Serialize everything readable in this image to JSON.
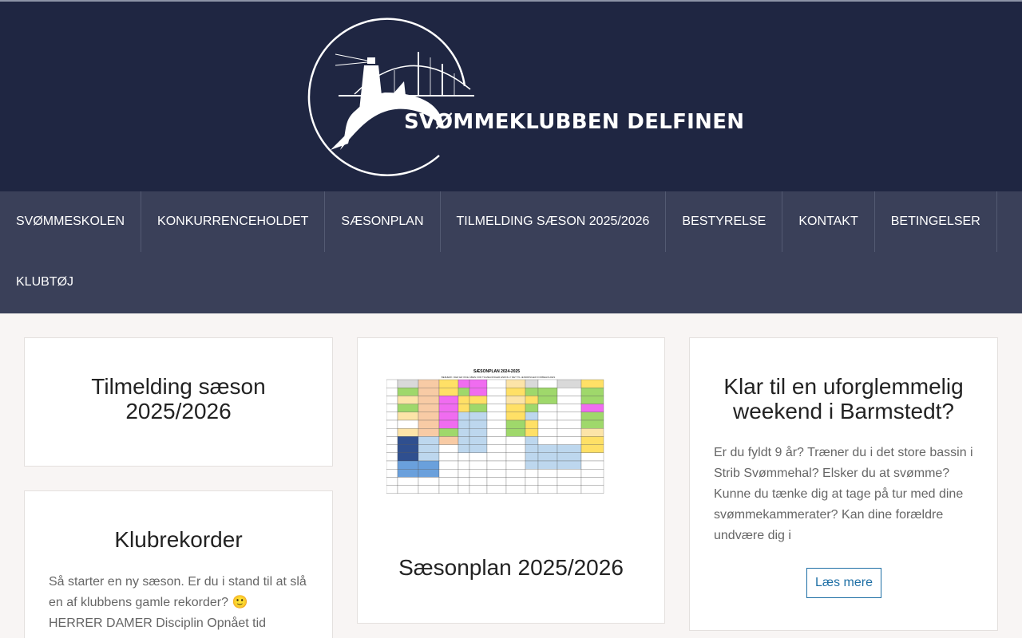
{
  "site": {
    "name": "SVØMMEKLUBBEN DELFINEN",
    "colors": {
      "header_bg": "#1f2642",
      "nav_bg": "#3a4059",
      "page_bg": "#f8f5f4",
      "link": "#1e6fa5"
    }
  },
  "nav": {
    "row1": [
      "SVØMMESKOLEN",
      "KONKURRENCEHOLDET",
      "SÆSONPLAN",
      "TILMELDING SÆSON 2025/2026",
      "BESTYRELSE",
      "KONTAKT",
      "BETINGELSER"
    ],
    "row2": [
      "KLUBTØJ"
    ]
  },
  "cards": {
    "registration": {
      "title": "Tilmelding sæson 2025/2026"
    },
    "records": {
      "title": "Klubrekorder",
      "excerpt_line1": "Så starter en ny sæson. Er du i stand til at slå en af klubbens gamle rekorder? 🙂",
      "excerpt_line2": "HERRER DAMER Disciplin Opnået tid"
    },
    "season_plan": {
      "title": "Sæsonplan 2025/2026",
      "image_title": "SÆSONPLAN 2024-2025",
      "image_subtitle": "BEMÆRK: DER ER IKKE ÅBEN FOR TILMELDINGER ENDNU // RET TIL ÆNDRINGER FORBEHOLDES"
    },
    "barmstedt": {
      "title": "Klar til en uforglemmelig weekend i Barmstedt?",
      "excerpt": "Er du fyldt 9 år? Træner du i det store bassin i Strib Svømmehal? Elsker du at svømme? Kunne du tænke dig at tage på tur med dine svømmekammerater? Kan dine forældre undvære dig i",
      "button": "Læs mere"
    }
  }
}
